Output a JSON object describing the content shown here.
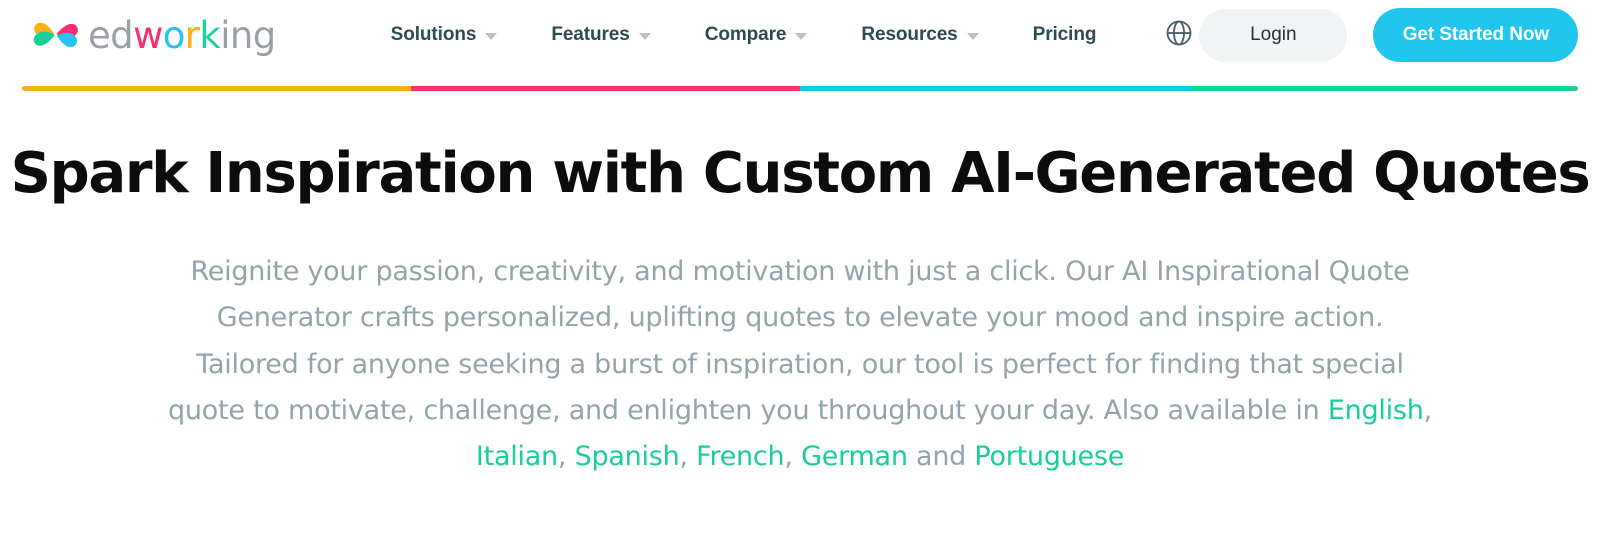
{
  "header": {
    "logo": {
      "alt": "edworking",
      "word_parts": [
        {
          "text": "ed",
          "color": "#9aa0a6"
        },
        {
          "text": "w",
          "color": "#fb2f6b"
        },
        {
          "text": "o",
          "color": "#25c3ee"
        },
        {
          "text": "r",
          "color": "#fbb014"
        },
        {
          "text": "k",
          "color": "#1ed1a0"
        },
        {
          "text": "ing",
          "color": "#9aa0a6"
        }
      ],
      "mark_colors": {
        "top_left": "#fbb014",
        "top_right": "#fb2f6b",
        "bottom_left": "#1ed1a0",
        "bottom_right": "#25c3ee"
      }
    },
    "nav": [
      {
        "label": "Solutions",
        "has_dropdown": true
      },
      {
        "label": "Features",
        "has_dropdown": true
      },
      {
        "label": "Compare",
        "has_dropdown": true
      },
      {
        "label": "Resources",
        "has_dropdown": true
      },
      {
        "label": "Pricing",
        "has_dropdown": false
      }
    ],
    "language_icon": "globe-icon",
    "login_label": "Login",
    "cta_label": "Get Started Now",
    "cta_color": "#21c6ee",
    "nav_text_color": "#2c4b55"
  },
  "colorbar": {
    "segments": [
      {
        "name": "amber",
        "color": "#fbb014",
        "width_pct": 25
      },
      {
        "name": "pink",
        "color": "#f9336b",
        "width_pct": 25
      },
      {
        "name": "cyan",
        "color": "#19c6f4",
        "width_pct": 25.2
      },
      {
        "name": "green",
        "color": "#17d48e",
        "width_pct": 24.8
      }
    ]
  },
  "hero": {
    "title": "Spark Inspiration with Custom AI-Generated Quotes",
    "paragraph_lead": "Reignite your passion, creativity, and motivation with just a click. Our AI Inspirational Quote Generator crafts personalized, uplifting quotes to elevate your mood and inspire action. Tailored for anyone seeking a burst of inspiration, our tool is perfect for finding that special quote to motivate, challenge, and enlighten you throughout your day. Also available in ",
    "languages": [
      {
        "label": "English"
      },
      {
        "label": "Italian"
      },
      {
        "label": "Spanish"
      },
      {
        "label": "French"
      },
      {
        "label": "German"
      },
      {
        "label": "Portuguese"
      }
    ],
    "separator": ", ",
    "conjunction": " and ",
    "link_color": "#18cf99",
    "text_color": "#93a5ab"
  }
}
